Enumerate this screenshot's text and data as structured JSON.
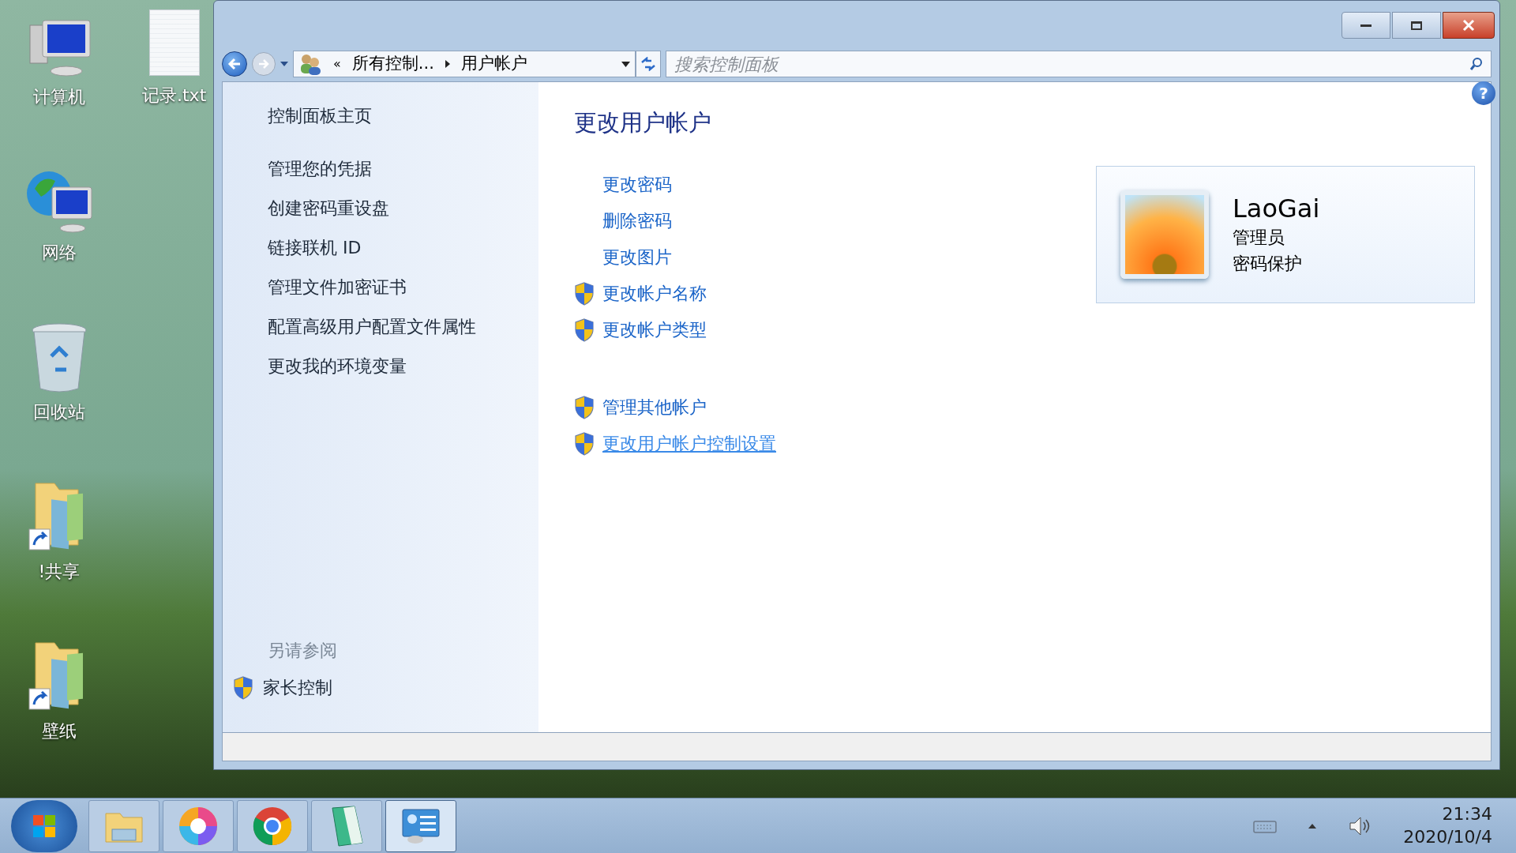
{
  "desktop_icons": [
    {
      "label": "计算机",
      "kind": "computer"
    },
    {
      "label": "网络",
      "kind": "network"
    },
    {
      "label": "回收站",
      "kind": "recycle"
    },
    {
      "label": "!共享",
      "kind": "folder"
    },
    {
      "label": "壁纸",
      "kind": "folder"
    }
  ],
  "desktop_file": {
    "label": "记录.txt"
  },
  "address_bar": {
    "overflow": "«",
    "crumbs": [
      "所有控制...",
      "用户帐户"
    ]
  },
  "search": {
    "placeholder": "搜索控制面板"
  },
  "sidebar": {
    "home": "控制面板主页",
    "items": [
      "管理您的凭据",
      "创建密码重设盘",
      "链接联机 ID",
      "管理文件加密证书",
      "配置高级用户配置文件属性",
      "更改我的环境变量"
    ],
    "see_also_title": "另请参阅",
    "see_also": [
      {
        "label": "家长控制",
        "kind": "admin"
      }
    ]
  },
  "main": {
    "title": "更改用户帐户",
    "groups": [
      [
        {
          "label": "更改密码",
          "kind": "plain",
          "hovered": false
        },
        {
          "label": "删除密码",
          "kind": "plain",
          "hovered": false
        },
        {
          "label": "更改图片",
          "kind": "plain",
          "hovered": false
        },
        {
          "label": "更改帐户名称",
          "kind": "admin",
          "hovered": false
        },
        {
          "label": "更改帐户类型",
          "kind": "admin",
          "hovered": false
        }
      ],
      [
        {
          "label": "管理其他帐户",
          "kind": "admin",
          "hovered": false
        },
        {
          "label": "更改用户帐户控制设置",
          "kind": "admin",
          "hovered": true
        }
      ]
    ]
  },
  "help": {
    "label": "?"
  },
  "account": {
    "name": "LaoGai",
    "role": "管理员",
    "status": "密码保护"
  },
  "taskbar": {
    "apps": [
      {
        "kind": "explorer",
        "selected": false
      },
      {
        "kind": "pinwheel",
        "selected": false
      },
      {
        "kind": "chrome",
        "selected": false
      },
      {
        "kind": "notebook",
        "selected": false
      },
      {
        "kind": "control-panel",
        "selected": true
      }
    ],
    "time": "21:34",
    "date": "2020/10/4"
  }
}
